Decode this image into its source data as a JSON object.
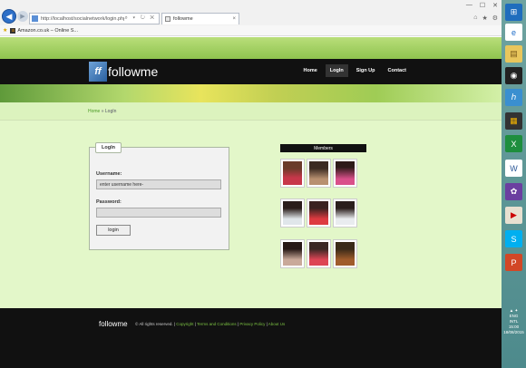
{
  "browser": {
    "url": "http://localhost/socialnetwork/login.php",
    "tab_label": "followme",
    "tab_close": "×",
    "favorites_item": "Amazon.co.uk – Online S...",
    "address_icons": "⌕ ▾ ↻ ✕",
    "window_controls": [
      "—",
      "☐",
      "✕"
    ],
    "tools": [
      "⌂",
      "★",
      "⚙"
    ]
  },
  "site": {
    "logo_mark": "ff",
    "logo_text": "followme",
    "nav": [
      "Home",
      "LogIn",
      "Sign Up",
      "Contact"
    ],
    "active_nav": "LogIn",
    "breadcrumb": {
      "home": "Home",
      "sep": "»",
      "current": "LogIn"
    }
  },
  "login": {
    "legend": "LogIn",
    "username_label": "Username:",
    "username_value": "enter username here-",
    "password_label": "Password:",
    "password_value": "",
    "button": "login"
  },
  "members": {
    "title": "Members"
  },
  "footer": {
    "logo": "followme",
    "copyright": "© All rights reserved.",
    "links": [
      "Copyright",
      "Terms and Conditions",
      "Privacy Policy",
      "About Us"
    ]
  },
  "taskbar": {
    "tray_lang": "ENG",
    "tray_region": "INTL",
    "time": "15:00",
    "date": "18/08/2015"
  }
}
